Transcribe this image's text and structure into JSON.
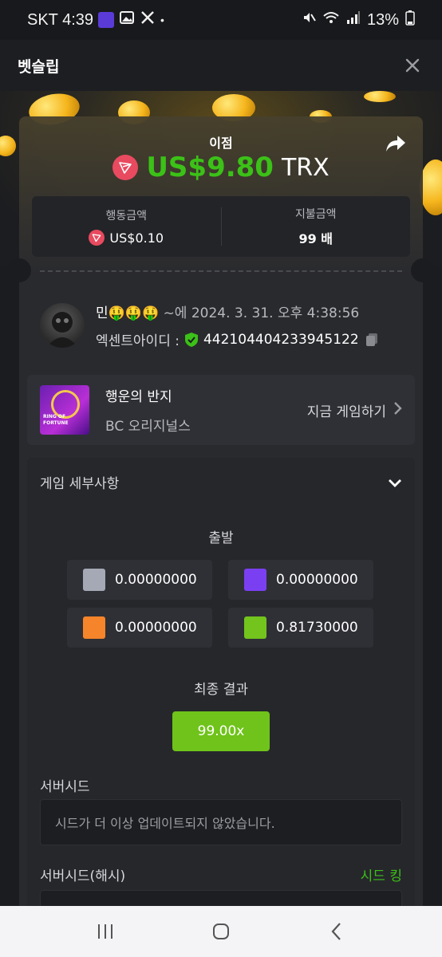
{
  "status_bar": {
    "carrier_time": "SKT 4:39",
    "battery": "13%"
  },
  "header": {
    "title": "벳슬립"
  },
  "win": {
    "label": "이점",
    "amount": "US$9.80",
    "currency": "TRX"
  },
  "stats": {
    "bet_label": "행동금액",
    "bet_value": "US$0.10",
    "payout_label": "지불금액",
    "payout_value": "99 배"
  },
  "player": {
    "name": "민🤑🤑🤑",
    "time_prefix": "~에",
    "datetime": "2024. 3. 31. 오후 4:38:56",
    "id_label": "엑센트아이디 :",
    "id_value": "442104404233945122"
  },
  "game": {
    "thumb_line1": "RING OF",
    "thumb_line2": "FORTUNE",
    "name": "행운의 반지",
    "provider": "BC 오리지널스",
    "play_label": "지금 게임하기"
  },
  "details": {
    "title": "게임 세부사항",
    "start_label": "출발",
    "tiles": [
      {
        "color": "#a4a9b5",
        "value": "0.00000000"
      },
      {
        "color": "#7b3ff2",
        "value": "0.00000000"
      },
      {
        "color": "#f5842a",
        "value": "0.00000000"
      },
      {
        "color": "#73c41c",
        "value": "0.81730000"
      }
    ],
    "final_label": "최종 결과",
    "final_value": "99.00x",
    "server_seed_label": "서버시드",
    "server_seed_value": "시드가 더 이상 업데이트되지 않았습니다.",
    "server_seed_hash_label": "서버시드(해시)",
    "seed_king_label": "시드 킹"
  },
  "colors": {
    "win_green": "#3bc117",
    "trx_red": "#e84a5f",
    "final_green": "#6fc31a"
  },
  "icons": [
    "x-social-icon",
    "gallery-icon",
    "mute-icon",
    "wifi-icon",
    "signal-icon",
    "battery-icon",
    "close-icon",
    "share-icon",
    "trx-icon",
    "shield-check-icon",
    "copy-icon",
    "chevron-right-icon",
    "chevron-down-icon",
    "recent-apps-icon",
    "home-icon",
    "back-icon"
  ]
}
